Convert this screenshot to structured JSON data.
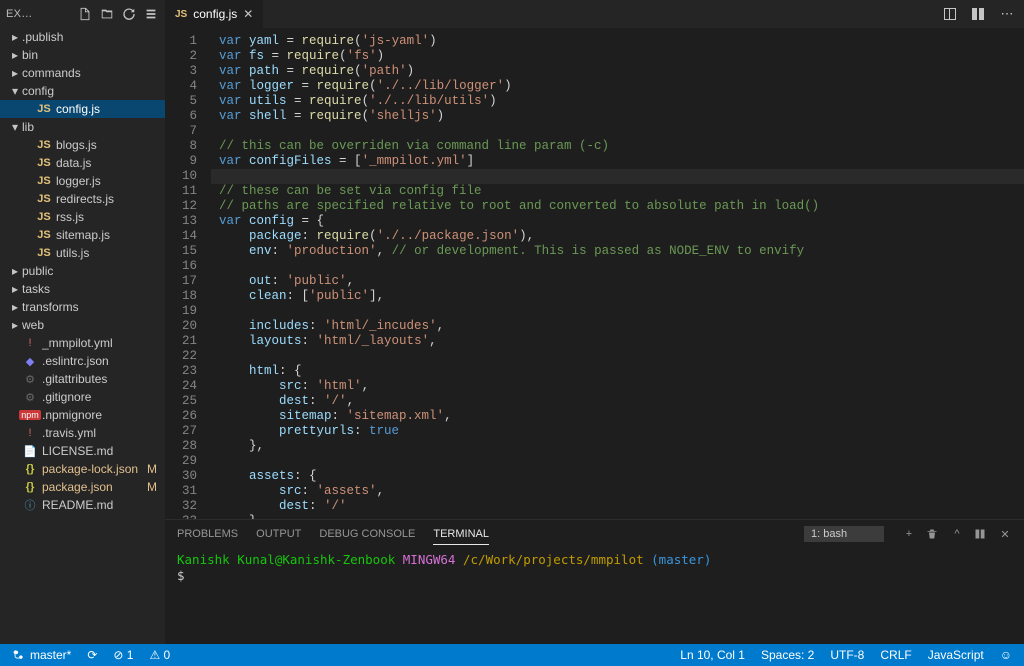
{
  "sidebar": {
    "title": "EX…",
    "actions": [
      "new-file",
      "new-folder",
      "refresh",
      "collapse"
    ],
    "tree": [
      {
        "type": "folder",
        "label": ".publish",
        "depth": 1,
        "open": false
      },
      {
        "type": "folder",
        "label": "bin",
        "depth": 1,
        "open": false
      },
      {
        "type": "folder",
        "label": "commands",
        "depth": 1,
        "open": false
      },
      {
        "type": "folder",
        "label": "config",
        "depth": 1,
        "open": true
      },
      {
        "type": "file",
        "label": "config.js",
        "depth": 2,
        "icon": "js",
        "active": true
      },
      {
        "type": "folder",
        "label": "lib",
        "depth": 1,
        "open": true
      },
      {
        "type": "file",
        "label": "blogs.js",
        "depth": 2,
        "icon": "js"
      },
      {
        "type": "file",
        "label": "data.js",
        "depth": 2,
        "icon": "js"
      },
      {
        "type": "file",
        "label": "logger.js",
        "depth": 2,
        "icon": "js"
      },
      {
        "type": "file",
        "label": "redirects.js",
        "depth": 2,
        "icon": "js"
      },
      {
        "type": "file",
        "label": "rss.js",
        "depth": 2,
        "icon": "js"
      },
      {
        "type": "file",
        "label": "sitemap.js",
        "depth": 2,
        "icon": "js"
      },
      {
        "type": "file",
        "label": "utils.js",
        "depth": 2,
        "icon": "js"
      },
      {
        "type": "folder",
        "label": "public",
        "depth": 1,
        "open": false
      },
      {
        "type": "folder",
        "label": "tasks",
        "depth": 1,
        "open": false
      },
      {
        "type": "folder",
        "label": "transforms",
        "depth": 1,
        "open": false
      },
      {
        "type": "folder",
        "label": "web",
        "depth": 1,
        "open": false
      },
      {
        "type": "file",
        "label": "_mmpilot.yml",
        "depth": 1,
        "icon": "yml"
      },
      {
        "type": "file",
        "label": ".eslintrc.json",
        "depth": 1,
        "icon": "eslint"
      },
      {
        "type": "file",
        "label": ".gitattributes",
        "depth": 1,
        "icon": "git"
      },
      {
        "type": "file",
        "label": ".gitignore",
        "depth": 1,
        "icon": "git"
      },
      {
        "type": "file",
        "label": ".npmignore",
        "depth": 1,
        "icon": "npm"
      },
      {
        "type": "file",
        "label": ".travis.yml",
        "depth": 1,
        "icon": "yml"
      },
      {
        "type": "file",
        "label": "LICENSE.md",
        "depth": 1,
        "icon": "license"
      },
      {
        "type": "file",
        "label": "package-lock.json",
        "depth": 1,
        "icon": "json",
        "mod": "M"
      },
      {
        "type": "file",
        "label": "package.json",
        "depth": 1,
        "icon": "json",
        "mod": "M"
      },
      {
        "type": "file",
        "label": "README.md",
        "depth": 1,
        "icon": "md"
      }
    ]
  },
  "tab": {
    "icon": "js",
    "label": "config.js"
  },
  "code_lines": [
    [
      {
        "t": "var",
        "c": "k-var"
      },
      {
        "t": " yaml ",
        "c": "k-id"
      },
      {
        "t": "= ",
        "c": "k-pun"
      },
      {
        "t": "require",
        "c": "k-fn"
      },
      {
        "t": "(",
        "c": "k-pun"
      },
      {
        "t": "'js-yaml'",
        "c": "k-str"
      },
      {
        "t": ")",
        "c": "k-pun"
      }
    ],
    [
      {
        "t": "var",
        "c": "k-var"
      },
      {
        "t": " fs ",
        "c": "k-id"
      },
      {
        "t": "= ",
        "c": "k-pun"
      },
      {
        "t": "require",
        "c": "k-fn"
      },
      {
        "t": "(",
        "c": "k-pun"
      },
      {
        "t": "'fs'",
        "c": "k-str"
      },
      {
        "t": ")",
        "c": "k-pun"
      }
    ],
    [
      {
        "t": "var",
        "c": "k-var"
      },
      {
        "t": " path ",
        "c": "k-id"
      },
      {
        "t": "= ",
        "c": "k-pun"
      },
      {
        "t": "require",
        "c": "k-fn"
      },
      {
        "t": "(",
        "c": "k-pun"
      },
      {
        "t": "'path'",
        "c": "k-str"
      },
      {
        "t": ")",
        "c": "k-pun"
      }
    ],
    [
      {
        "t": "var",
        "c": "k-var"
      },
      {
        "t": " logger ",
        "c": "k-id"
      },
      {
        "t": "= ",
        "c": "k-pun"
      },
      {
        "t": "require",
        "c": "k-fn"
      },
      {
        "t": "(",
        "c": "k-pun"
      },
      {
        "t": "'./../lib/logger'",
        "c": "k-str"
      },
      {
        "t": ")",
        "c": "k-pun"
      }
    ],
    [
      {
        "t": "var",
        "c": "k-var"
      },
      {
        "t": " utils ",
        "c": "k-id"
      },
      {
        "t": "= ",
        "c": "k-pun"
      },
      {
        "t": "require",
        "c": "k-fn"
      },
      {
        "t": "(",
        "c": "k-pun"
      },
      {
        "t": "'./../lib/utils'",
        "c": "k-str"
      },
      {
        "t": ")",
        "c": "k-pun"
      }
    ],
    [
      {
        "t": "var",
        "c": "k-var"
      },
      {
        "t": " shell ",
        "c": "k-id"
      },
      {
        "t": "= ",
        "c": "k-pun"
      },
      {
        "t": "require",
        "c": "k-fn"
      },
      {
        "t": "(",
        "c": "k-pun"
      },
      {
        "t": "'shelljs'",
        "c": "k-str"
      },
      {
        "t": ")",
        "c": "k-pun"
      }
    ],
    [],
    [
      {
        "t": "// this can be overriden via command line param (-c)",
        "c": "k-cmt"
      }
    ],
    [
      {
        "t": "var",
        "c": "k-var"
      },
      {
        "t": " configFiles ",
        "c": "k-id"
      },
      {
        "t": "= [",
        "c": "k-pun"
      },
      {
        "t": "'_mmpilot.yml'",
        "c": "k-str"
      },
      {
        "t": "]",
        "c": "k-pun"
      }
    ],
    [],
    [
      {
        "t": "// these can be set via config file",
        "c": "k-cmt"
      }
    ],
    [
      {
        "t": "// paths are specified relative to root and converted to absolute path in load()",
        "c": "k-cmt"
      }
    ],
    [
      {
        "t": "var",
        "c": "k-var"
      },
      {
        "t": " config ",
        "c": "k-id"
      },
      {
        "t": "= {",
        "c": "k-pun"
      }
    ],
    [
      {
        "t": "    ",
        "c": ""
      },
      {
        "t": "package",
        "c": "k-prop"
      },
      {
        "t": ": ",
        "c": "k-pun"
      },
      {
        "t": "require",
        "c": "k-fn"
      },
      {
        "t": "(",
        "c": "k-pun"
      },
      {
        "t": "'./../package.json'",
        "c": "k-str"
      },
      {
        "t": "),",
        "c": "k-pun"
      }
    ],
    [
      {
        "t": "    ",
        "c": ""
      },
      {
        "t": "env",
        "c": "k-prop"
      },
      {
        "t": ": ",
        "c": "k-pun"
      },
      {
        "t": "'production'",
        "c": "k-str"
      },
      {
        "t": ", ",
        "c": "k-pun"
      },
      {
        "t": "// or development. This is passed as NODE_ENV to envify",
        "c": "k-cmt"
      }
    ],
    [],
    [
      {
        "t": "    ",
        "c": ""
      },
      {
        "t": "out",
        "c": "k-prop"
      },
      {
        "t": ": ",
        "c": "k-pun"
      },
      {
        "t": "'public'",
        "c": "k-str"
      },
      {
        "t": ",",
        "c": "k-pun"
      }
    ],
    [
      {
        "t": "    ",
        "c": ""
      },
      {
        "t": "clean",
        "c": "k-prop"
      },
      {
        "t": ": [",
        "c": "k-pun"
      },
      {
        "t": "'public'",
        "c": "k-str"
      },
      {
        "t": "],",
        "c": "k-pun"
      }
    ],
    [],
    [
      {
        "t": "    ",
        "c": ""
      },
      {
        "t": "includes",
        "c": "k-prop"
      },
      {
        "t": ": ",
        "c": "k-pun"
      },
      {
        "t": "'html/_incudes'",
        "c": "k-str"
      },
      {
        "t": ",",
        "c": "k-pun"
      }
    ],
    [
      {
        "t": "    ",
        "c": ""
      },
      {
        "t": "layouts",
        "c": "k-prop"
      },
      {
        "t": ": ",
        "c": "k-pun"
      },
      {
        "t": "'html/_layouts'",
        "c": "k-str"
      },
      {
        "t": ",",
        "c": "k-pun"
      }
    ],
    [],
    [
      {
        "t": "    ",
        "c": ""
      },
      {
        "t": "html",
        "c": "k-prop"
      },
      {
        "t": ": {",
        "c": "k-pun"
      }
    ],
    [
      {
        "t": "        ",
        "c": ""
      },
      {
        "t": "src",
        "c": "k-prop"
      },
      {
        "t": ": ",
        "c": "k-pun"
      },
      {
        "t": "'html'",
        "c": "k-str"
      },
      {
        "t": ",",
        "c": "k-pun"
      }
    ],
    [
      {
        "t": "        ",
        "c": ""
      },
      {
        "t": "dest",
        "c": "k-prop"
      },
      {
        "t": ": ",
        "c": "k-pun"
      },
      {
        "t": "'/'",
        "c": "k-str"
      },
      {
        "t": ",",
        "c": "k-pun"
      }
    ],
    [
      {
        "t": "        ",
        "c": ""
      },
      {
        "t": "sitemap",
        "c": "k-prop"
      },
      {
        "t": ": ",
        "c": "k-pun"
      },
      {
        "t": "'sitemap.xml'",
        "c": "k-str"
      },
      {
        "t": ",",
        "c": "k-pun"
      }
    ],
    [
      {
        "t": "        ",
        "c": ""
      },
      {
        "t": "prettyurls",
        "c": "k-prop"
      },
      {
        "t": ": ",
        "c": "k-pun"
      },
      {
        "t": "true",
        "c": "k-const"
      }
    ],
    [
      {
        "t": "    },",
        "c": "k-pun"
      }
    ],
    [],
    [
      {
        "t": "    ",
        "c": ""
      },
      {
        "t": "assets",
        "c": "k-prop"
      },
      {
        "t": ": {",
        "c": "k-pun"
      }
    ],
    [
      {
        "t": "        ",
        "c": ""
      },
      {
        "t": "src",
        "c": "k-prop"
      },
      {
        "t": ": ",
        "c": "k-pun"
      },
      {
        "t": "'assets'",
        "c": "k-str"
      },
      {
        "t": ",",
        "c": "k-pun"
      }
    ],
    [
      {
        "t": "        ",
        "c": ""
      },
      {
        "t": "dest",
        "c": "k-prop"
      },
      {
        "t": ": ",
        "c": "k-pun"
      },
      {
        "t": "'/'",
        "c": "k-str"
      }
    ],
    [
      {
        "t": "    },",
        "c": "k-pun"
      }
    ],
    []
  ],
  "cursor_line": 10,
  "panel": {
    "tabs": [
      "PROBLEMS",
      "OUTPUT",
      "DEBUG CONSOLE",
      "TERMINAL"
    ],
    "active": 3,
    "shell_select": "1: bash",
    "prompt_user": "Kanishk Kunal@Kanishk-Zenbook",
    "prompt_env": "MINGW64",
    "prompt_path": "/c/Work/projects/mmpilot",
    "prompt_branch": "(master)",
    "prompt_cursor": "$"
  },
  "status": {
    "branch": "master*",
    "sync": "⟳",
    "errors": "⊘ 1",
    "warnings": "⚠ 0",
    "position": "Ln 10, Col 1",
    "spaces": "Spaces: 2",
    "encoding": "UTF-8",
    "eol": "CRLF",
    "language": "JavaScript",
    "smiley": "☺"
  }
}
